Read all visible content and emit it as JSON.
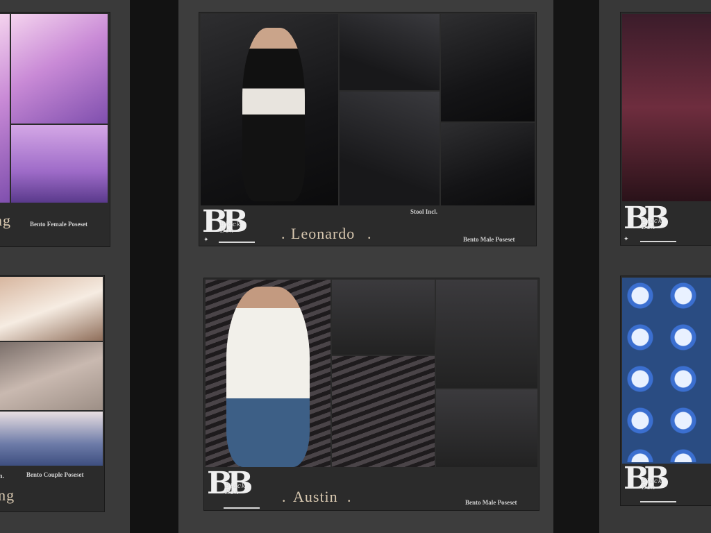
{
  "brand": {
    "logo_text": "BB",
    "logo_sub": "Black Box",
    "logo_tag": "POSES"
  },
  "posters": {
    "left_top": {
      "title_partial": "ng",
      "caption": "Bento Female Poseset"
    },
    "left_bottom": {
      "title_partial": "ing",
      "caption": "Bento Couple Poseset",
      "note_partial": "n."
    },
    "center_top": {
      "title": "Leonardo",
      "note": "Stool Incl.",
      "caption": "Bento Male Poseset"
    },
    "center_bottom": {
      "title": "Austin",
      "caption": "Bento Male Poseset"
    }
  },
  "icons": {
    "sparkle": "✦",
    "dot": "."
  }
}
